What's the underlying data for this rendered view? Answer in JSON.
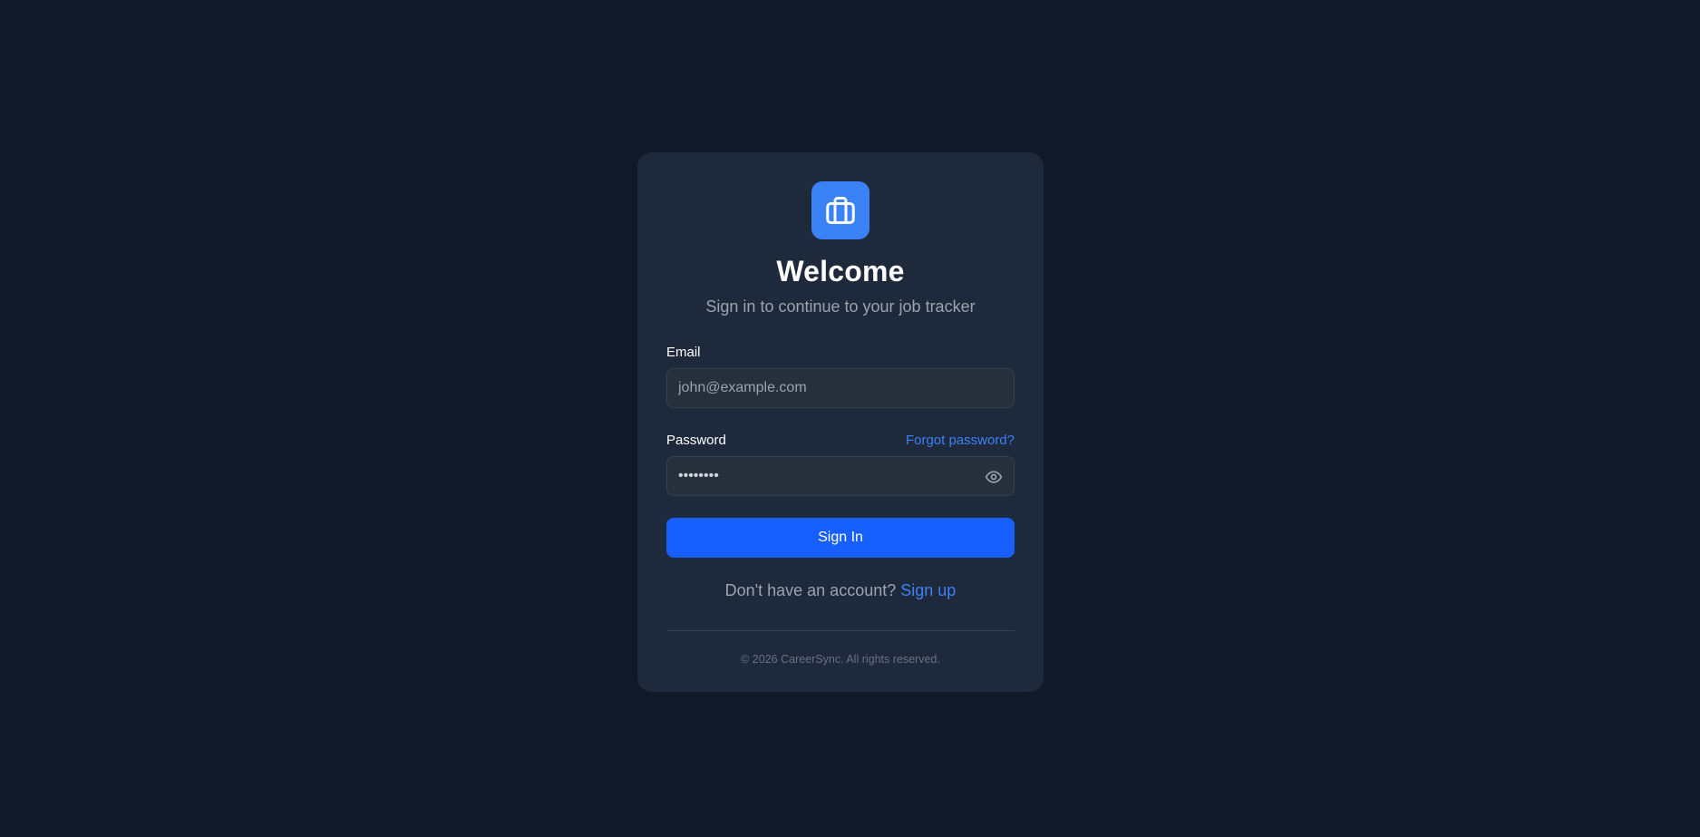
{
  "brand": {
    "logo_icon": "briefcase-icon",
    "accent_color": "#3b82f6",
    "button_color": "#1760ff"
  },
  "header": {
    "title": "Welcome",
    "subtitle": "Sign in to continue to your job tracker"
  },
  "form": {
    "email": {
      "label": "Email",
      "placeholder": "john@example.com",
      "value": ""
    },
    "password": {
      "label": "Password",
      "value": "password",
      "forgot_label": "Forgot password?",
      "toggle_icon": "eye-icon"
    },
    "submit_label": "Sign In"
  },
  "signup": {
    "prompt": "Don't have an account?",
    "link_label": "Sign up"
  },
  "footer": {
    "text": "© 2026 CareerSync. All rights reserved."
  }
}
